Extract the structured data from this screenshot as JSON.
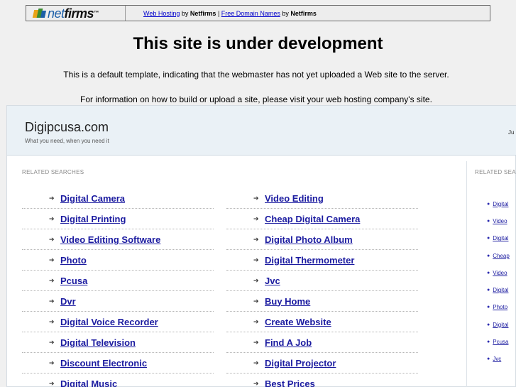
{
  "topbar": {
    "logo_net": "net",
    "logo_firms": "firms",
    "logo_tm": "™",
    "link1": "Web Hosting",
    "by1": "by",
    "brand1": "Netfirms",
    "sep": "|",
    "link2": "Free Domain Names",
    "by2": "by",
    "brand2": "Netfirms"
  },
  "headline": "This site is under development",
  "message1": "This is a default template, indicating that the webmaster has not yet uploaded a Web site to the server.",
  "message2": "For information on how to build or upload a site, please visit your web hosting company's site.",
  "site": {
    "title": "Digipcusa.com",
    "tagline": "What you need, when you need it",
    "date_fragment": "Ju"
  },
  "related_label": "RELATED SEARCHES",
  "related_label_right": "RELATED SEA",
  "left_column": [
    "Digital Camera",
    "Digital Printing",
    "Video Editing Software",
    "Photo",
    "Pcusa",
    "Dvr",
    "Digital Voice Recorder",
    "Digital Television",
    "Discount Electronic",
    "Digital Music"
  ],
  "right_column": [
    "Video Editing",
    "Cheap Digital Camera",
    "Digital Photo Album",
    "Digital Thermometer",
    "Jvc",
    "Buy Home",
    "Create Website",
    "Find A Job",
    "Digital Projector",
    "Best Prices"
  ],
  "side_list": [
    "Digital",
    "Video",
    "Digital",
    "Cheap",
    "Video",
    "Digital",
    "Photo",
    "Digital",
    "Pcusa",
    "Jvc"
  ],
  "arrow_glyph": "➔",
  "bullet_glyph": "●",
  "colors": {
    "link": "#1b1ba0",
    "header_bg": "#eaf1f6",
    "page_bg": "#f0f0f0"
  }
}
